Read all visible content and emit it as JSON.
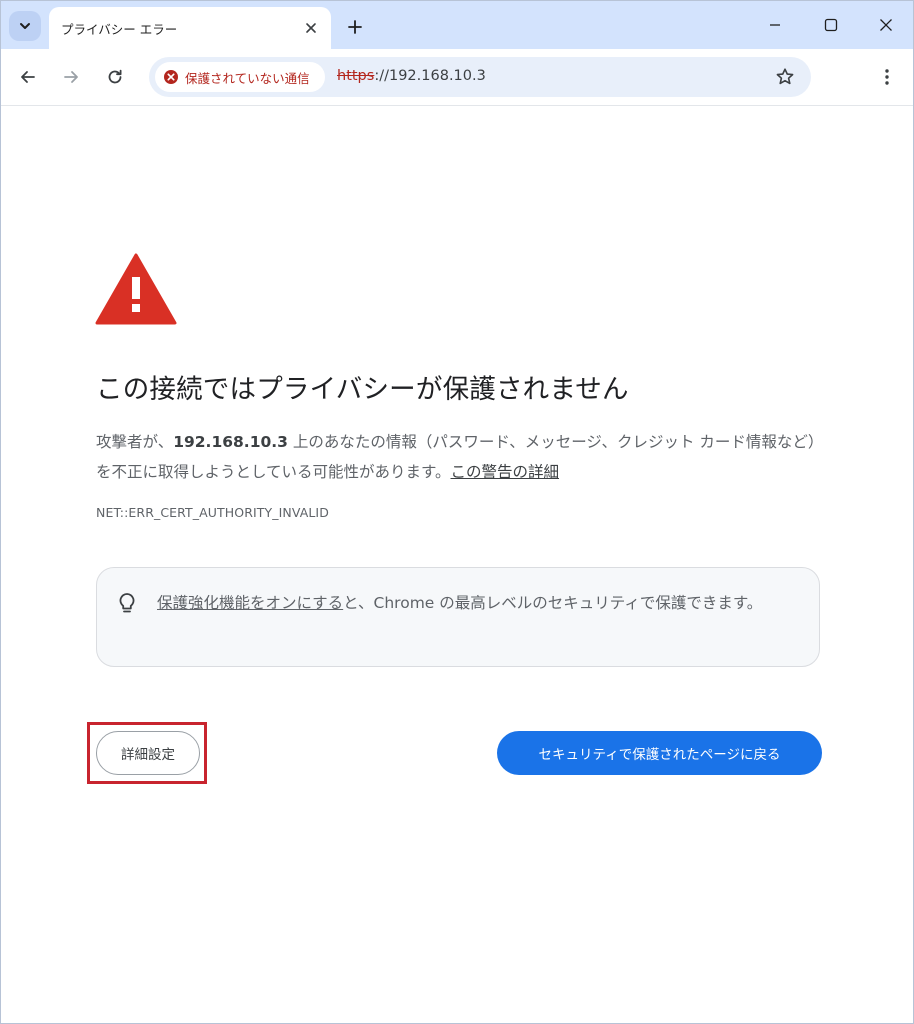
{
  "tab": {
    "title": "プライバシー エラー"
  },
  "address_bar": {
    "security_label": "保護されていない通信",
    "url_scheme": "https",
    "url_rest": "://192.168.10.3"
  },
  "icons": {
    "tab_search": "chevron-down-icon",
    "tab_close": "close-icon",
    "new_tab": "plus-icon",
    "minimize": "minimize-icon",
    "maximize": "maximize-icon",
    "close_window": "close-icon",
    "back": "arrow-left-icon",
    "forward": "arrow-right-icon",
    "reload": "reload-icon",
    "not_secure": "error-circle-icon",
    "bookmark": "star-icon",
    "menu": "three-dots-vertical-icon",
    "warning": "warning-triangle-icon",
    "tip": "lightbulb-icon"
  },
  "colors": {
    "accent_blue": "#1a73e8",
    "warning_red": "#d93025",
    "not_secure_red": "#b3261e",
    "highlight_frame": "#c8242e"
  },
  "interstitial": {
    "heading": "この接続ではプライバシーが保護されません",
    "body_prefix": "攻撃者が、",
    "host": "192.168.10.3",
    "body_middle": " 上のあなたの情報（パスワード、メッセージ、クレジット カード情報など）を不正に取得しようとしている可能性があります。",
    "learn_more_link": "この警告の詳細",
    "error_code": "NET::ERR_CERT_AUTHORITY_INVALID",
    "enhanced_link": "保護強化機能をオンにする",
    "enhanced_rest": "と、Chrome の最高レベルのセキュリティで保護できます。",
    "details_button": "詳細設定",
    "back_button": "セキュリティで保護されたページに戻る"
  }
}
